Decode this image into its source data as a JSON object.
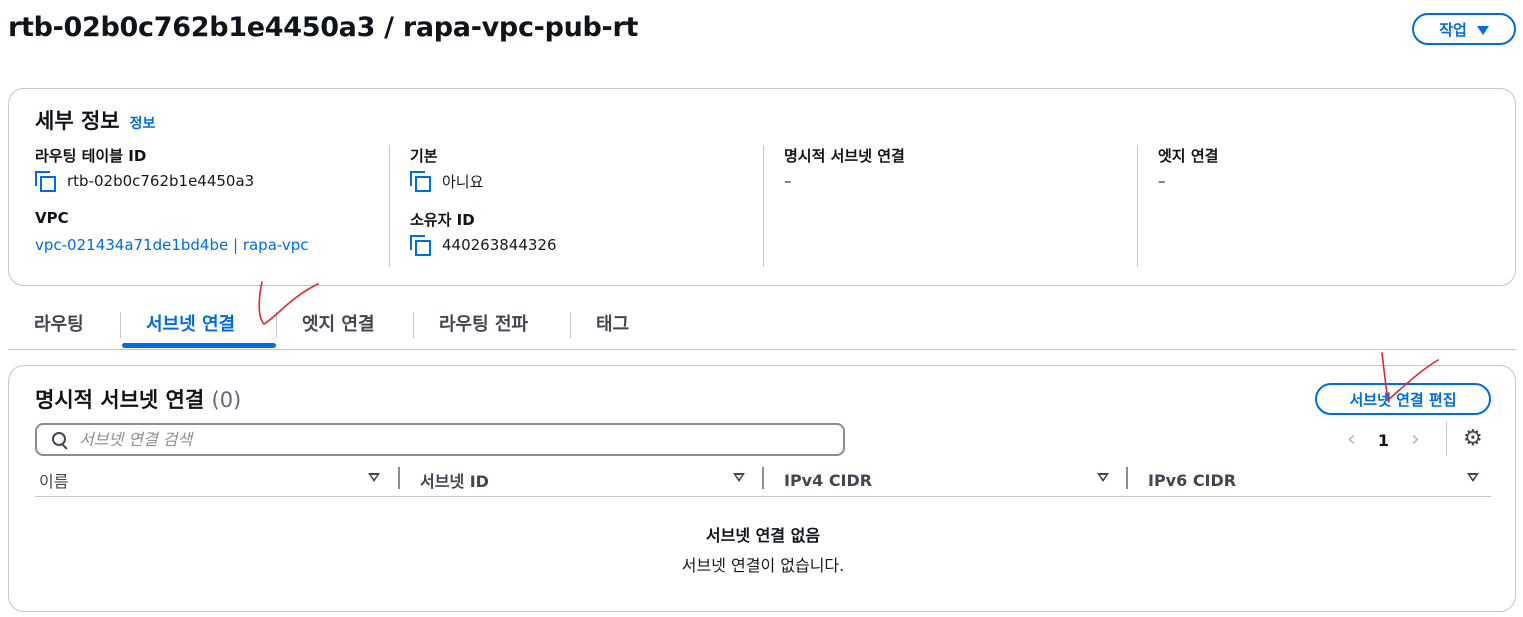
{
  "header": {
    "title": "rtb-02b0c762b1e4450a3 / rapa-vpc-pub-rt",
    "actions_label": "작업"
  },
  "details": {
    "title": "세부 정보",
    "info_link": "정보",
    "route_table_id_label": "라우팅 테이블 ID",
    "route_table_id": "rtb-02b0c762b1e4450a3",
    "vpc_label": "VPC",
    "vpc_value": "vpc-021434a71de1bd4be | rapa-vpc",
    "main_label": "기본",
    "main_value": "아니요",
    "owner_label": "소유자 ID",
    "owner_value": "440263844326",
    "explicit_label": "명시적 서브넷 연결",
    "explicit_value": "–",
    "edge_label": "엣지 연결",
    "edge_value": "–"
  },
  "tabs": [
    {
      "label": "라우팅",
      "active": false
    },
    {
      "label": "서브넷 연결",
      "active": true
    },
    {
      "label": "엣지 연결",
      "active": false
    },
    {
      "label": "라우팅 전파",
      "active": false
    },
    {
      "label": "태그",
      "active": false
    }
  ],
  "associations": {
    "title": "명시적 서브넷 연결",
    "count": "(0)",
    "edit_button": "서브넷 연결 편집",
    "search_placeholder": "서브넷 연결 검색",
    "page": "1",
    "columns": [
      "이름",
      "서브넷 ID",
      "IPv4 CIDR",
      "IPv6 CIDR"
    ],
    "empty_title": "서브넷 연결 없음",
    "empty_desc": "서브넷 연결이 없습니다."
  },
  "colors": {
    "accent": "#006ce0",
    "annotation": "#e0282e"
  }
}
